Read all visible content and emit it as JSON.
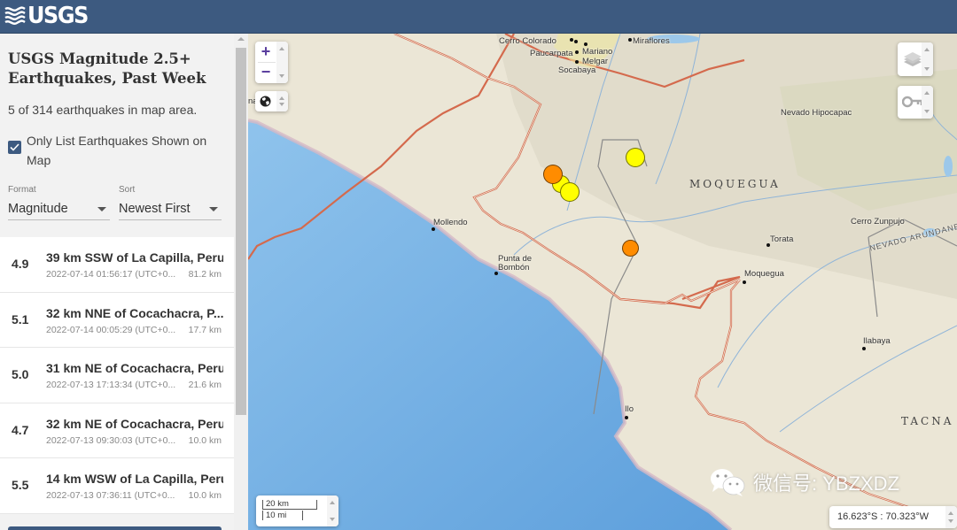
{
  "header": {
    "logo_text": "USGS",
    "brand_color": "#3d5a80"
  },
  "sidebar": {
    "title": "USGS Magnitude 2.5+ Earthquakes, Past Week",
    "count_text": "5 of 314 earthquakes in map area.",
    "only_list_checkbox": {
      "label": "Only List Earthquakes Shown on Map",
      "checked": true
    },
    "format": {
      "label": "Format",
      "value": "Magnitude"
    },
    "sort": {
      "label": "Sort",
      "value": "Newest First"
    },
    "earthquakes": [
      {
        "mag": "4.9",
        "place": "39 km SSW of La Capilla, Peru",
        "time": "2022-07-14 01:56:17 (UTC+0...",
        "depth": "81.2 km"
      },
      {
        "mag": "5.1",
        "place": "32 km NNE of Cocachacra, P...",
        "time": "2022-07-14 00:05:29 (UTC+0...",
        "depth": "17.7 km"
      },
      {
        "mag": "5.0",
        "place": "31 km NE of Cocachacra, Peru",
        "time": "2022-07-13 17:13:34 (UTC+0...",
        "depth": "21.6 km"
      },
      {
        "mag": "4.7",
        "place": "32 km NE of Cocachacra, Peru",
        "time": "2022-07-13 09:30:03 (UTC+0...",
        "depth": "10.0 km"
      },
      {
        "mag": "5.5",
        "place": "14 km WSW of La Capilla, Peru",
        "time": "2022-07-13 07:36:11 (UTC+0...",
        "depth": "10.0 km"
      }
    ]
  },
  "map": {
    "controls": {
      "zoom_in": "+",
      "zoom_out": "−",
      "scale_km": "20 km",
      "scale_mi": "10 mi",
      "coordinates": "16.623°S : 70.323°W"
    },
    "icons": {
      "globe": "globe-icon",
      "layers": "layers-icon",
      "key": "key-icon"
    },
    "places": {
      "cerro_colorado": "Cerro Colorado",
      "paucarpata": "Paucarpata",
      "mariano_melgar_1": "Mariano",
      "mariano_melgar_2": "Melgar",
      "socabaya": "Socabaya",
      "miraflores": "Miraflores",
      "nevado_hipocapac": "Nevado Hipocapac",
      "mollendo": "Mollendo",
      "punta_de_bombon_1": "Punta de",
      "punta_de_bombon_2": "Bombón",
      "moquegua_city": "Moquegua",
      "torata": "Torata",
      "cerro_zunpujo": "Cerro Zunpujo",
      "ilabaya": "Ilabaya",
      "ilo": "Ilo",
      "partial_left": "na"
    },
    "regions": {
      "moquegua": "MOQUEGUA",
      "tacna": "TACNA",
      "nevado_arundane": "NEVADO ARUNDANE"
    },
    "quake_colors": {
      "orange": "#ff8c00",
      "yellow": "#ffff00"
    }
  },
  "watermark": {
    "text": "微信号: YBZXDZ"
  }
}
